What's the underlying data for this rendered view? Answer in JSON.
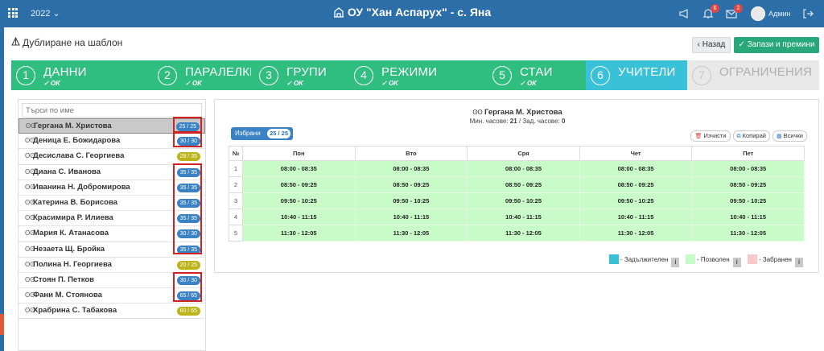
{
  "topbar": {
    "year": "2022 ⌄",
    "school": "ОУ \"Хан Аспарух\" - с. Яна",
    "notif_count": "6",
    "mail_count": "2",
    "user": "Админ"
  },
  "header": {
    "title": "Дублиране на шаблон",
    "back_label": "Назад",
    "save_label": "Запази и премини"
  },
  "steps": [
    {
      "num": "1",
      "label": "ДАННИ",
      "ok": "OK"
    },
    {
      "num": "2",
      "label": "ПАРАЛЕЛКИ",
      "ok": "OK"
    },
    {
      "num": "3",
      "label": "ГРУПИ",
      "ok": "OK"
    },
    {
      "num": "4",
      "label": "РЕЖИМИ",
      "ok": "OK"
    },
    {
      "num": "5",
      "label": "СТАИ",
      "ok": "OK"
    },
    {
      "num": "6",
      "label": "УЧИТЕЛИ",
      "ok": ""
    },
    {
      "num": "7",
      "label": "ОГРАНИЧЕНИЯ",
      "ok": ""
    }
  ],
  "search": {
    "placeholder": "Търси по име"
  },
  "teachers": [
    {
      "name": "Гергана М. Христова",
      "count": "25 / 25"
    },
    {
      "name": "Деница Е. Божидарова",
      "count": "30 / 30"
    },
    {
      "name": "Десислава С. Георгиева",
      "count": "28 / 35"
    },
    {
      "name": "Диана С. Иванова",
      "count": "35 / 35"
    },
    {
      "name": "Иванина Н. Добромирова",
      "count": "35 / 35"
    },
    {
      "name": "Катерина В. Борисова",
      "count": "35 / 35"
    },
    {
      "name": "Красимира Р. Илиева",
      "count": "35 / 35"
    },
    {
      "name": "Мария К. Атанасова",
      "count": "30 / 30"
    },
    {
      "name": "Незаета Щ. Бройка",
      "count": "35 / 35"
    },
    {
      "name": "Полина Н. Георгиева",
      "count": "20 / 25"
    },
    {
      "name": "Стоян П. Петков",
      "count": "30 / 30"
    },
    {
      "name": "Фани М. Стоянова",
      "count": "65 / 65"
    },
    {
      "name": "Храбрина С. Табакова",
      "count": "60 / 65"
    }
  ],
  "selected_teacher": {
    "name": "Гергана М. Христова",
    "min_label": "Мин. часове:",
    "min_value": "21",
    "req_label": "/ Зад. часове:",
    "req_value": "0"
  },
  "selection": {
    "label": "Избрани",
    "count": "25 / 25"
  },
  "tools": {
    "clear": "Изчисти",
    "copy": "Копирай",
    "all": "Всички"
  },
  "schedule": {
    "num_header": "№",
    "days": [
      "Пон",
      "Вто",
      "Сря",
      "Чет",
      "Пет"
    ],
    "rows": [
      {
        "n": "1",
        "time": "08:00 - 08:35"
      },
      {
        "n": "2",
        "time": "08:50 - 09:25"
      },
      {
        "n": "3",
        "time": "09:50 - 10:25"
      },
      {
        "n": "4",
        "time": "10:40 - 11:15"
      },
      {
        "n": "5",
        "time": "11:30 - 12:05"
      }
    ]
  },
  "legend": {
    "mandatory": "- Задължителен",
    "allowed": "- Позволен",
    "forbidden": "- Забранен",
    "info": "i"
  },
  "colors": {
    "topbar": "#2b6ea8",
    "step_done": "#2fbd80",
    "step_active": "#39c2d7",
    "step_todo": "#e8e8e8",
    "allowed": "#c9fbc9",
    "mandatory": "#39c2d7",
    "forbidden": "#f7c9c9",
    "pill_blue": "#3a82c4",
    "pill_olive": "#bdb31b",
    "highlight_box": "#d32020"
  }
}
